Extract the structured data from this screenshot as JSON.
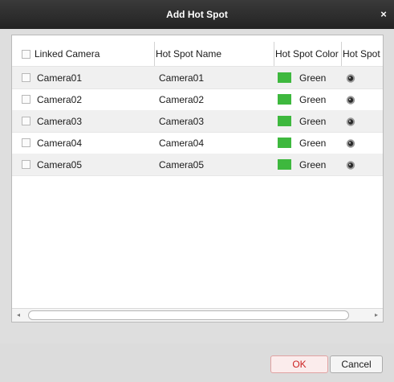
{
  "dialog": {
    "title": "Add Hot Spot",
    "close_glyph": "×"
  },
  "table": {
    "headers": {
      "linked_camera": "Linked Camera",
      "hot_spot_name": "Hot Spot Name",
      "hot_spot_color": "Hot Spot Color",
      "hot_spot_icon": "Hot Spot Ic"
    },
    "rows": [
      {
        "camera": "Camera01",
        "name": "Camera01",
        "color": "Green",
        "checked": false,
        "icon": "camera-icon"
      },
      {
        "camera": "Camera02",
        "name": "Camera02",
        "color": "Green",
        "checked": false,
        "icon": "camera-icon"
      },
      {
        "camera": "Camera03",
        "name": "Camera03",
        "color": "Green",
        "checked": false,
        "icon": "camera-icon"
      },
      {
        "camera": "Camera04",
        "name": "Camera04",
        "color": "Green",
        "checked": false,
        "icon": "camera-icon"
      },
      {
        "camera": "Camera05",
        "name": "Camera05",
        "color": "Green",
        "checked": false,
        "icon": "camera-icon"
      }
    ],
    "swatch_color": "#3eb83e"
  },
  "scrollbar": {
    "left_glyph": "◂",
    "right_glyph": "▸"
  },
  "buttons": {
    "ok": "OK",
    "cancel": "Cancel"
  }
}
